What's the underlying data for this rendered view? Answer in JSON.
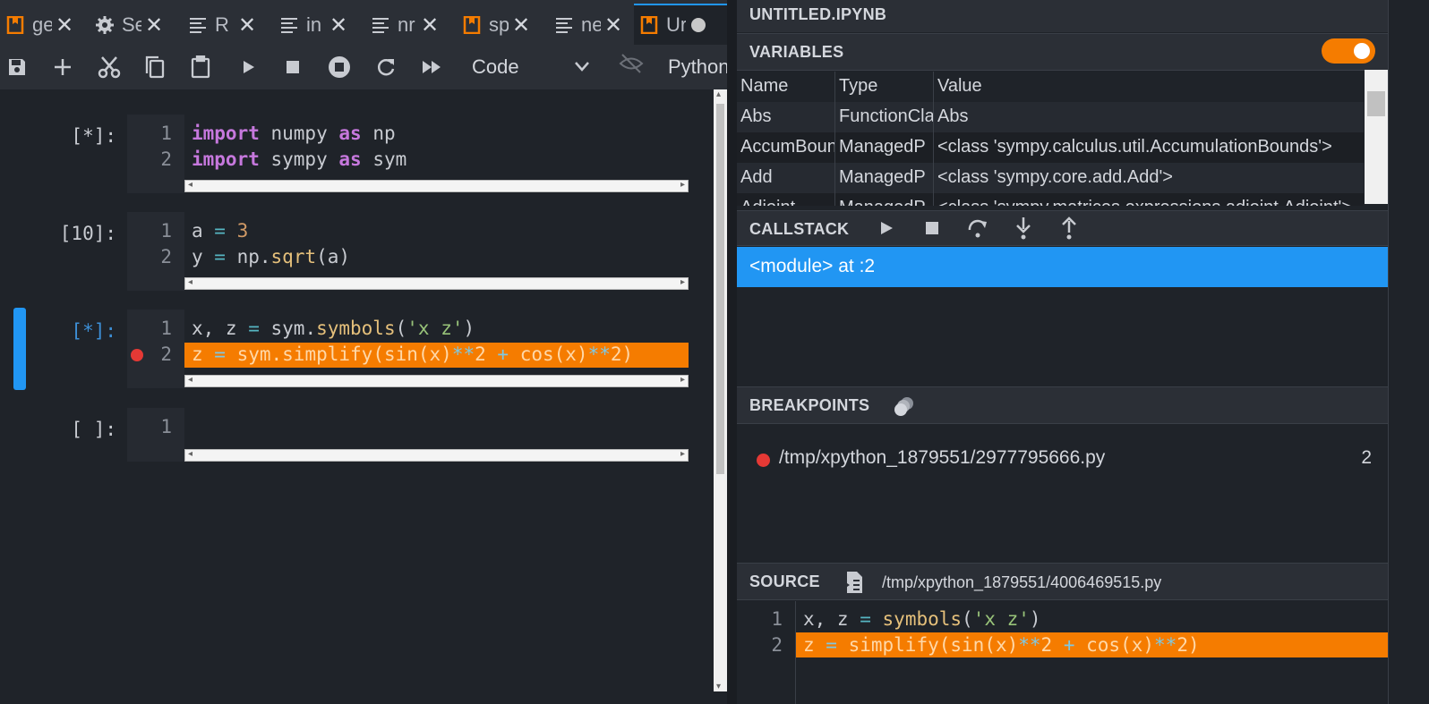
{
  "tabs": [
    {
      "label": "ge",
      "icon": "notebook-icon"
    },
    {
      "label": "Se",
      "icon": "gear-icon"
    },
    {
      "label": "R",
      "icon": "text-file-icon"
    },
    {
      "label": "in",
      "icon": "text-file-icon"
    },
    {
      "label": "nr",
      "icon": "text-file-icon"
    },
    {
      "label": "sp",
      "icon": "notebook-icon"
    },
    {
      "label": "ne",
      "icon": "text-file-icon"
    },
    {
      "label": "Ur",
      "icon": "notebook-icon",
      "active": true
    }
  ],
  "toolbar": {
    "cell_type": "Code",
    "kernel": "Python"
  },
  "cells": [
    {
      "prompt": "[*]:",
      "lines": [
        "1",
        "2"
      ]
    },
    {
      "prompt": "[10]:",
      "lines": [
        "1",
        "2"
      ]
    },
    {
      "prompt": "[*]:",
      "lines": [
        "1",
        "2"
      ]
    },
    {
      "prompt": "[ ]:",
      "lines": [
        "1"
      ]
    }
  ],
  "debugger": {
    "title": "UNTITLED.IPYNB",
    "variables": {
      "title": "VARIABLES",
      "columns": [
        "Name",
        "Type",
        "Value"
      ],
      "rows": [
        [
          "Abs",
          "FunctionCla",
          "Abs"
        ],
        [
          "AccumBoun",
          "ManagedP",
          "<class 'sympy.calculus.util.AccumulationBounds'>"
        ],
        [
          "Add",
          "ManagedP",
          "<class 'sympy.core.add.Add'>"
        ],
        [
          "Adjoint",
          "ManagedP",
          "<class 'sympy.matrices.expressions.adjoint.Adjoint'>"
        ]
      ]
    },
    "callstack": {
      "title": "CALLSTACK",
      "frame": "<module> at :2"
    },
    "breakpoints": {
      "title": "BREAKPOINTS",
      "path": "/tmp/xpython_1879551/2977795666.py",
      "line": "2"
    },
    "source": {
      "title": "SOURCE",
      "path": "/tmp/xpython_1879551/4006469515.py",
      "lines": [
        "1",
        "2"
      ]
    }
  },
  "colors": {
    "accent": "#2196f3",
    "highlight": "#f57c00",
    "breakpoint": "#e53935"
  }
}
